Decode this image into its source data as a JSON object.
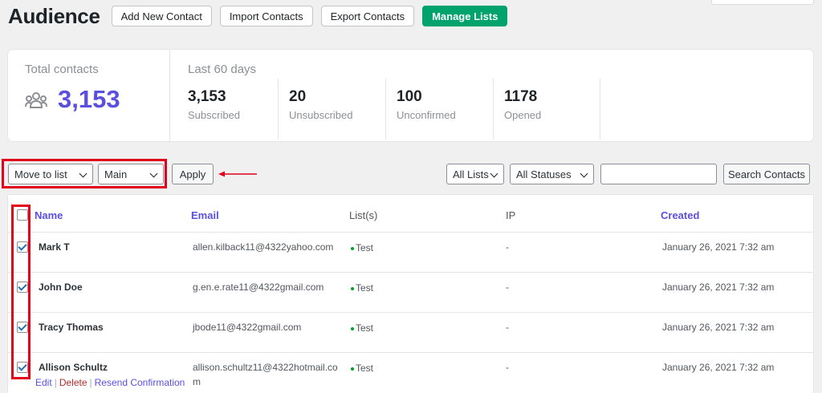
{
  "header": {
    "title": "Audience",
    "buttons": [
      "Add New Contact",
      "Import Contacts",
      "Export Contacts",
      "Manage Lists"
    ]
  },
  "stats": {
    "total_label": "Total contacts",
    "total_value": "3,153",
    "period_label": "Last 60 days",
    "items": [
      {
        "value": "3,153",
        "label": "Subscribed"
      },
      {
        "value": "20",
        "label": "Unsubscribed"
      },
      {
        "value": "100",
        "label": "Unconfirmed"
      },
      {
        "value": "1178",
        "label": "Opened"
      }
    ]
  },
  "bulk": {
    "action_selected": "Move to list",
    "list_selected": "Main",
    "apply_label": "Apply"
  },
  "filters": {
    "lists_selected": "All Lists",
    "status_selected": "All Statuses",
    "search_value": "",
    "search_button": "Search Contacts"
  },
  "table": {
    "columns": [
      "Name",
      "Email",
      "List(s)",
      "IP",
      "Created"
    ],
    "rows": [
      {
        "name": "Mark T",
        "email": "allen.kilback11@4322yahoo.com",
        "lists": "Test",
        "ip": "-",
        "created": "January 26, 2021 7:32 am",
        "checked": true
      },
      {
        "name": "John Doe",
        "email": "g.en.e.rate11@4322gmail.com",
        "lists": "Test",
        "ip": "-",
        "created": "January 26, 2021 7:32 am",
        "checked": true
      },
      {
        "name": "Tracy Thomas",
        "email": "jbode11@4322gmail.com",
        "lists": "Test",
        "ip": "-",
        "created": "January 26, 2021 7:32 am",
        "checked": true
      },
      {
        "name": "Allison Schultz",
        "email_line1": "allison.schultz11@4322hotmail.co",
        "email_line2": "m",
        "lists": "Test",
        "ip": "-",
        "created": "January 26, 2021 7:32 am",
        "checked": true
      }
    ],
    "row_actions": {
      "edit": "Edit",
      "delete": "Delete",
      "resend": "Resend Confirmation",
      "sep": "|"
    }
  },
  "colors": {
    "accent": "#5b4fe0",
    "primary_button": "#00a36c",
    "highlight": "#e0001b",
    "status_dot": "#00a32a"
  }
}
